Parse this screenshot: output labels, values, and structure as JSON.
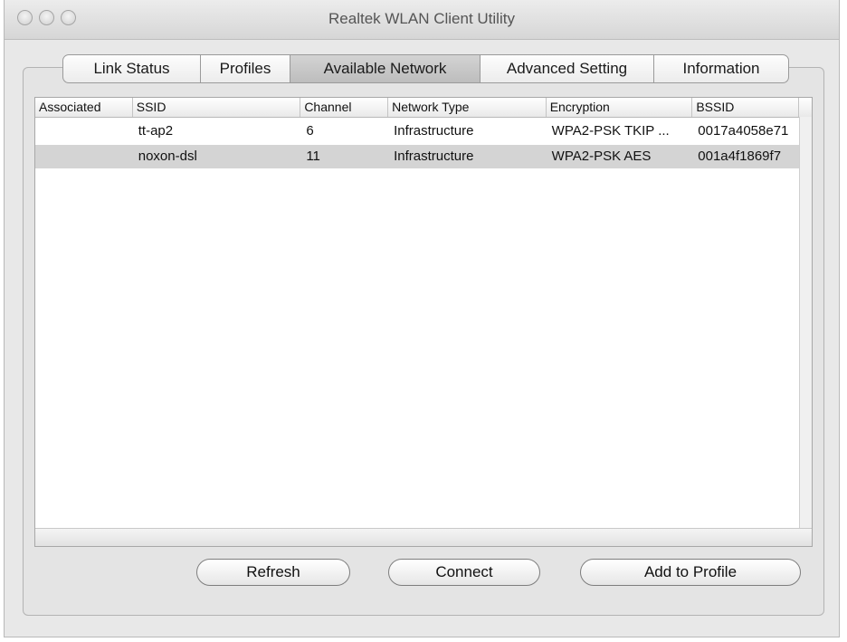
{
  "window": {
    "title": "Realtek WLAN Client Utility"
  },
  "tabs": [
    {
      "label": "Link Status",
      "active": false
    },
    {
      "label": "Profiles",
      "active": false
    },
    {
      "label": "Available Network",
      "active": true
    },
    {
      "label": "Advanced Setting",
      "active": false
    },
    {
      "label": "Information",
      "active": false
    }
  ],
  "table": {
    "columns": [
      "Associated",
      "SSID",
      "Channel",
      "Network Type",
      "Encryption",
      "BSSID"
    ],
    "rows": [
      {
        "associated": "",
        "ssid": "tt-ap2",
        "channel": "6",
        "network_type": "Infrastructure",
        "encryption": "WPA2-PSK TKIP ...",
        "bssid": "0017a4058e71",
        "selected": false
      },
      {
        "associated": "",
        "ssid": "noxon-dsl",
        "channel": "11",
        "network_type": "Infrastructure",
        "encryption": "WPA2-PSK AES",
        "bssid": "001a4f1869f7",
        "selected": true
      }
    ]
  },
  "buttons": {
    "refresh": "Refresh",
    "connect": "Connect",
    "add_to_profile": "Add to Profile"
  },
  "colors": {
    "selected_row": "#d4d4d4",
    "active_tab": "#c6c6c6"
  }
}
